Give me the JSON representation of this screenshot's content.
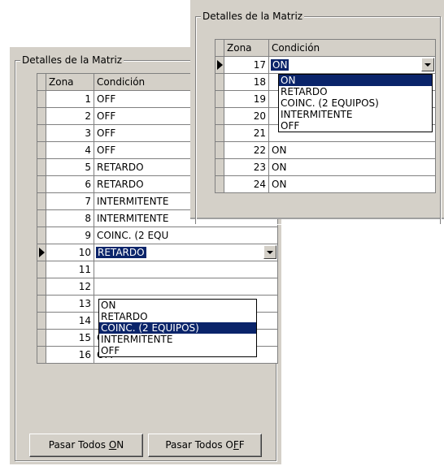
{
  "back": {
    "group_label": "Detalles de la Matriz",
    "headers": {
      "zona": "Zona",
      "condicion": "Condición"
    },
    "rows": [
      {
        "zona": "1",
        "condicion": "OFF"
      },
      {
        "zona": "2",
        "condicion": "OFF"
      },
      {
        "zona": "3",
        "condicion": "OFF"
      },
      {
        "zona": "4",
        "condicion": "OFF"
      },
      {
        "zona": "5",
        "condicion": "RETARDO"
      },
      {
        "zona": "6",
        "condicion": "RETARDO"
      },
      {
        "zona": "7",
        "condicion": "INTERMITENTE"
      },
      {
        "zona": "8",
        "condicion": "INTERMITENTE"
      },
      {
        "zona": "9",
        "condicion": "COINC. (2 EQU"
      },
      {
        "zona": "10",
        "condicion": "RETARDO"
      },
      {
        "zona": "11",
        "condicion": ""
      },
      {
        "zona": "12",
        "condicion": ""
      },
      {
        "zona": "13",
        "condicion": ""
      },
      {
        "zona": "14",
        "condicion": ""
      },
      {
        "zona": "15",
        "condicion": "OFF"
      },
      {
        "zona": "16",
        "condicion": "OFF"
      }
    ],
    "dropdown_options": [
      "ON",
      "RETARDO",
      "COINC. (2 EQUIPOS)",
      "INTERMITENTE",
      "OFF"
    ],
    "dropdown_highlighted": "COINC. (2 EQUIPOS)",
    "button_on_prefix": "Pasar Todos ",
    "button_on_mnemonic": "O",
    "button_on_suffix": "N",
    "button_off_prefix": "Pasar Todos O",
    "button_off_mnemonic": "F",
    "button_off_suffix": "F"
  },
  "front": {
    "group_label": "Detalles de la Matriz",
    "headers": {
      "zona": "Zona",
      "condicion": "Condición"
    },
    "rows": [
      {
        "zona": "17",
        "condicion": "ON"
      },
      {
        "zona": "18",
        "condicion": ""
      },
      {
        "zona": "19",
        "condicion": ""
      },
      {
        "zona": "20",
        "condicion": ""
      },
      {
        "zona": "21",
        "condicion": ""
      },
      {
        "zona": "22",
        "condicion": "ON"
      },
      {
        "zona": "23",
        "condicion": "ON"
      },
      {
        "zona": "24",
        "condicion": "ON"
      }
    ],
    "dropdown_options": [
      "ON",
      "RETARDO",
      "COINC. (2 EQUIPOS)",
      "INTERMITENTE",
      "OFF"
    ],
    "dropdown_highlighted": "ON"
  }
}
